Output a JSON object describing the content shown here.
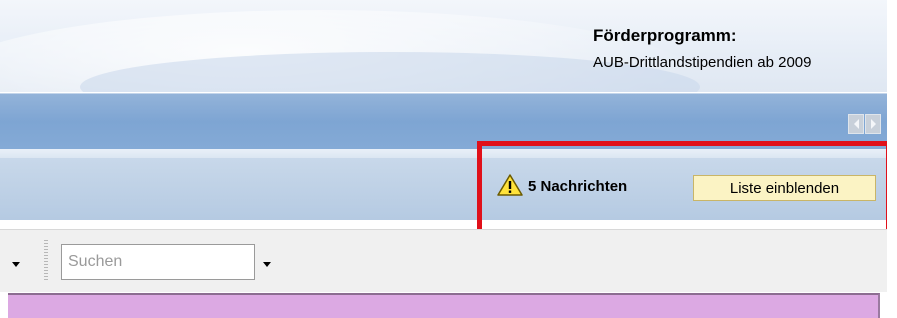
{
  "header": {
    "program_label": "Förderprogramm:",
    "program_value": "AUB-Drittlandstipendien ab 2009"
  },
  "messages": {
    "count_text": "5 Nachrichten",
    "show_list_label": "Liste einblenden"
  },
  "toolbar": {
    "search_placeholder": "Suchen"
  },
  "icons": {
    "warning": "warning-icon",
    "scroll_left": "chevron-left-icon",
    "scroll_right": "chevron-right-icon",
    "dropdown": "chevron-down-icon"
  },
  "colors": {
    "highlight": "#e0101a",
    "button_bg": "#fbf3c4",
    "panel": "#dca9e3",
    "nav_bar": "#84aad6"
  }
}
